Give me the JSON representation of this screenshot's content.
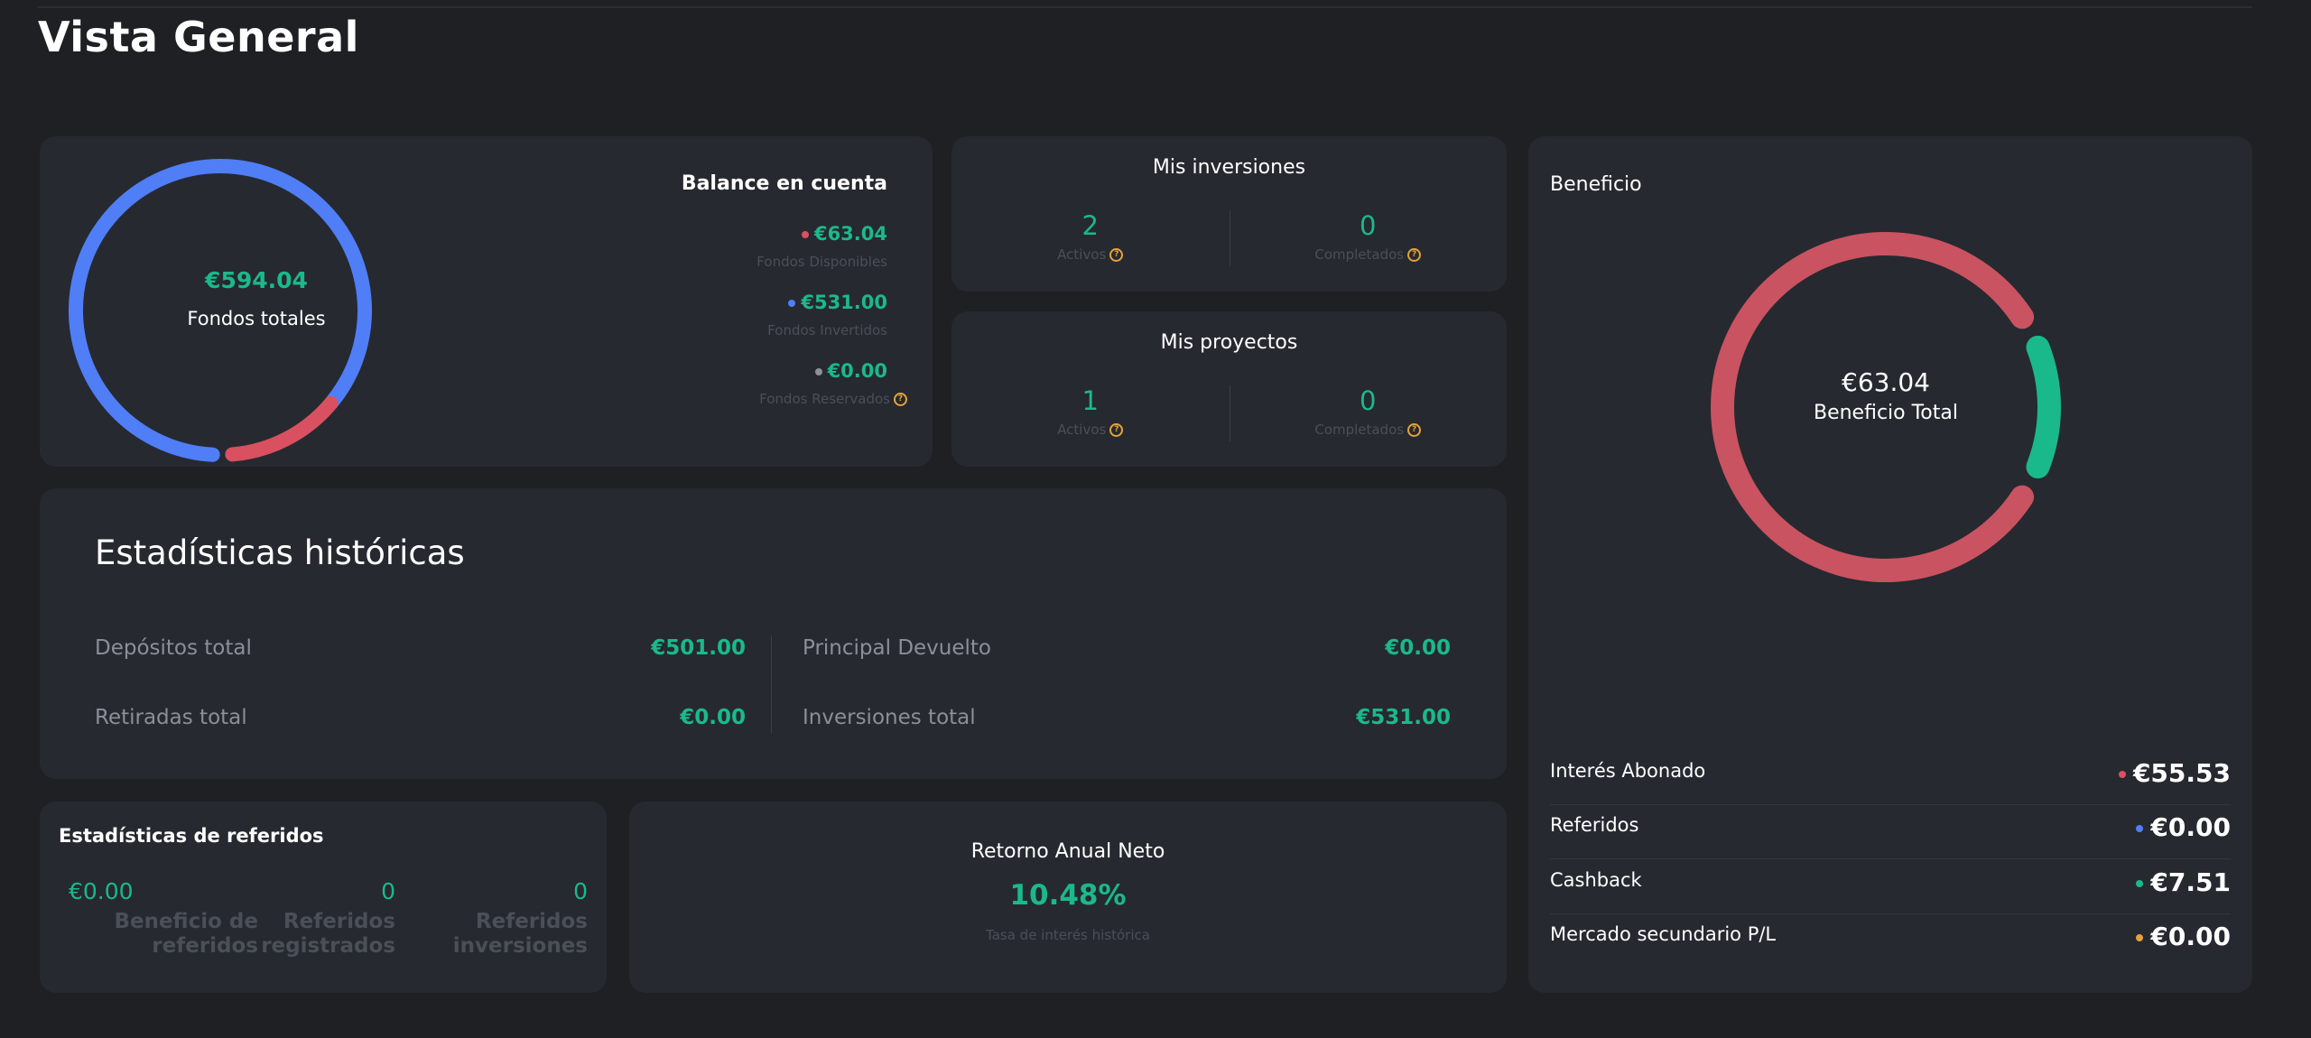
{
  "page": {
    "title": "Vista General"
  },
  "balance": {
    "total_amount": "€594.04",
    "total_label": "Fondos totales",
    "title": "Balance en cuenta",
    "items": [
      {
        "amount": "€63.04",
        "label": "Fondos Disponibles",
        "color": "#d95160"
      },
      {
        "amount": "€531.00",
        "label": "Fondos Invertidos",
        "color": "#4f7ef7"
      },
      {
        "amount": "€0.00",
        "label": "Fondos Reservados",
        "color": "#8c9098"
      }
    ],
    "ring": {
      "available_fraction": 0.106,
      "invested_fraction": 0.894
    }
  },
  "inversiones": {
    "title": "Mis inversiones",
    "activos_value": "2",
    "activos_label": "Activos",
    "completados_value": "0",
    "completados_label": "Completados"
  },
  "proyectos": {
    "title": "Mis proyectos",
    "activos_value": "1",
    "activos_label": "Activos",
    "completados_value": "0",
    "completados_label": "Completados"
  },
  "historicas": {
    "title": "Estadísticas históricas",
    "depositos_label": "Depósitos total",
    "depositos_value": "€501.00",
    "retiradas_label": "Retiradas total",
    "retiradas_value": "€0.00",
    "principal_label": "Principal Devuelto",
    "principal_value": "€0.00",
    "inversiones_label": "Inversiones total",
    "inversiones_value": "€531.00"
  },
  "referidos": {
    "title": "Estadísticas de referidos",
    "beneficio_value": "€0.00",
    "beneficio_label_1": "Beneficio de",
    "beneficio_label_2": "referidos",
    "registrados_value": "0",
    "registrados_label_1": "Referidos",
    "registrados_label_2": "registrados",
    "inversiones_value": "0",
    "inversiones_label_1": "Referidos",
    "inversiones_label_2": "inversiones"
  },
  "retorno": {
    "title": "Retorno Anual Neto",
    "value": "10.48%",
    "label": "Tasa de interés histórica"
  },
  "beneficio": {
    "title": "Beneficio",
    "total_amount": "€63.04",
    "total_label": "Beneficio Total",
    "ring": {
      "interes_fraction": 0.881,
      "cashback_fraction": 0.119
    },
    "rows": [
      {
        "label": "Interés Abonado",
        "value": "€55.53",
        "color": "#d95160"
      },
      {
        "label": "Referidos",
        "value": "€0.00",
        "color": "#4f7ef7"
      },
      {
        "label": "Cashback",
        "value": "€7.51",
        "color": "#1ab98b"
      },
      {
        "label": "Mercado secundario P/L",
        "value": "€0.00",
        "color": "#e5a23a"
      }
    ]
  },
  "colors": {
    "accent_green": "#1ab98b",
    "red": "#d95160",
    "blue": "#4f7ef7",
    "orange": "#e5a23a",
    "background": "#1e2024",
    "card": "#262930"
  }
}
